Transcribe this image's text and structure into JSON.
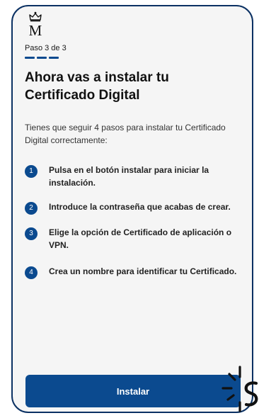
{
  "progress": {
    "label": "Paso 3 de 3",
    "current": 3,
    "total": 3
  },
  "heading": {
    "title": "Ahora vas a instalar tu Certificado Digital",
    "intro": "Tienes que seguir 4 pasos para instalar tu Certificado Digital correctamente:"
  },
  "steps": [
    {
      "number": "1",
      "text": "Pulsa en el botón instalar para iniciar la instalación."
    },
    {
      "number": "2",
      "text": "Introduce la contraseña que acabas de crear."
    },
    {
      "number": "3",
      "text": "Elige la opción de Certificado de aplicación o VPN."
    },
    {
      "number": "4",
      "text": "Crea un nombre para identificar tu Certificado."
    }
  ],
  "actions": {
    "install_label": "Instalar"
  },
  "colors": {
    "brand": "#0b4a8f",
    "border": "#0b3163",
    "background": "#f5f5f5"
  },
  "icons": {
    "logo": "crown-m-logo",
    "cursor": "tap-cursor-icon"
  }
}
